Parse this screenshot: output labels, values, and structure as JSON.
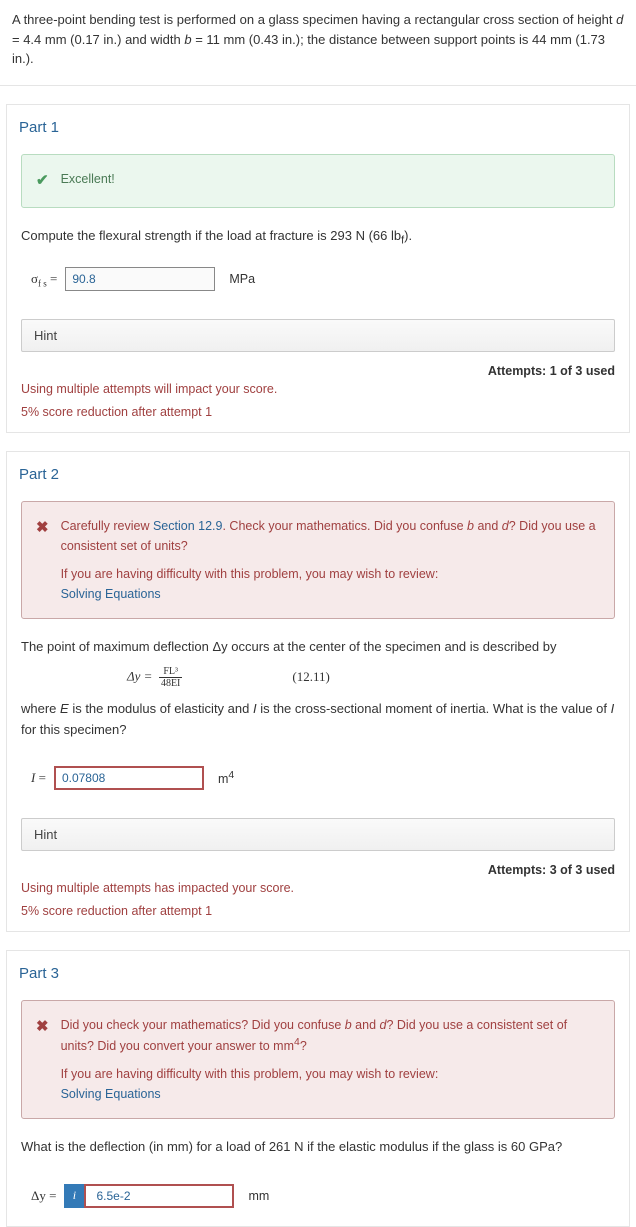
{
  "problem": {
    "text_a": "A three-point bending test is performed on a glass specimen having a rectangular cross section of height ",
    "d_var": "d",
    "d_val": " = 4.4 mm (0.17 in.) and width ",
    "b_var": "b",
    "b_val": " = 11 mm (0.43 in.); the distance between support points is 44 mm (1.73 in.)."
  },
  "part1": {
    "title": "Part 1",
    "feedback": {
      "icon": "✔",
      "text": "Excellent!"
    },
    "prompt_a": "Compute the flexural strength if the load at fracture is 293 N (66 lb",
    "prompt_sub": "f",
    "prompt_b": ").",
    "symbol_pre": "σ",
    "symbol_sub": "f s",
    "equals": " =",
    "value": "90.8",
    "unit": "MPa",
    "hint": "Hint",
    "attempts": "Attempts: 1 of 3 used",
    "note1": "Using multiple attempts will impact your score.",
    "note2": "5% score reduction after attempt 1"
  },
  "part2": {
    "title": "Part 2",
    "feedback": {
      "icon": "✖",
      "line1_a": "Carefully review ",
      "line1_link": "Section 12.9",
      "line1_b": ". Check your mathematics. Did you confuse ",
      "line1_i1": "b",
      "line1_c": " and ",
      "line1_i2": "d",
      "line1_d": "? Did you use a consistent set of units?",
      "line2": "If you are having difficulty with this problem, you may wish to review:",
      "line3_link": "Solving Equations"
    },
    "prompt1": "The point of maximum deflection Δy occurs at the center of the specimen and is described by",
    "eq_lhs": "Δy  =",
    "eq_num": "FL³",
    "eq_den": "48EI",
    "eq_ref": "(12.11)",
    "prompt2_a": "where ",
    "prompt2_E": "E",
    "prompt2_b": " is the modulus of elasticity and ",
    "prompt2_I": "I",
    "prompt2_c": " is the cross-sectional moment of inertia.  What is the value of ",
    "prompt2_I2": "I",
    "prompt2_d": " for this specimen?",
    "symbol": "I",
    "equals": " =",
    "value": "0.07808",
    "unit_base": "m",
    "unit_sup": "4",
    "hint": "Hint",
    "attempts": "Attempts: 3 of 3 used",
    "note1": "Using multiple attempts has impacted your score.",
    "note2": "5% score reduction after attempt 1"
  },
  "part3": {
    "title": "Part 3",
    "feedback": {
      "icon": "✖",
      "line1_a": "Did you check your mathematics? Did you confuse ",
      "line1_i1": "b",
      "line1_b": " and ",
      "line1_i2": "d",
      "line1_c": "? Did you use a consistent set of units? Did you convert your answer to mm",
      "line1_sup": "4",
      "line1_d": "?",
      "line2": "If you are having difficulty with this problem, you may wish to review:",
      "line3_link": "Solving Equations"
    },
    "prompt": "What is the deflection (in mm) for a load of 261 N if the elastic modulus if the glass is 60 GPa?",
    "symbol": "Δy",
    "equals": " =",
    "info": "i",
    "value": "6.5e-2",
    "unit": "mm"
  }
}
